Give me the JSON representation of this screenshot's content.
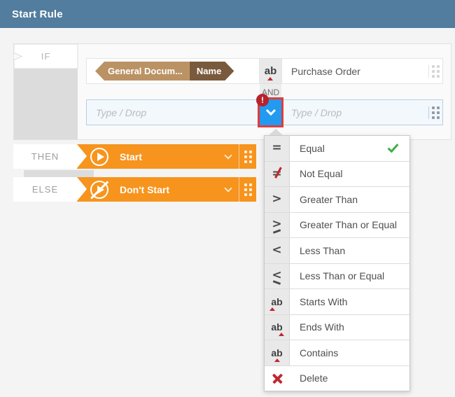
{
  "header": {
    "title": "Start Rule"
  },
  "rule": {
    "if_label": "IF",
    "and_label": "AND",
    "then_label": "THEN",
    "else_label": "ELSE",
    "condition1": {
      "tag_primary": "General Docum...",
      "tag_secondary": "Name",
      "operator_icon": "contains-icon",
      "value": "Purchase Order"
    },
    "condition2": {
      "left_placeholder": "Type / Drop",
      "right_placeholder": "Type / Drop",
      "error_badge": "!"
    },
    "then_action": "Start",
    "else_action": "Don't Start"
  },
  "operator_menu": {
    "items": [
      {
        "label": "Equal",
        "icon": "equal-icon",
        "selected": true
      },
      {
        "label": "Not Equal",
        "icon": "not-equal-icon",
        "selected": false
      },
      {
        "label": "Greater Than",
        "icon": "greater-than-icon",
        "selected": false
      },
      {
        "label": "Greater Than or Equal",
        "icon": "greater-than-or-equal-icon",
        "selected": false
      },
      {
        "label": "Less Than",
        "icon": "less-than-icon",
        "selected": false
      },
      {
        "label": "Less Than or Equal",
        "icon": "less-than-or-equal-icon",
        "selected": false
      },
      {
        "label": "Starts With",
        "icon": "starts-with-icon",
        "selected": false
      },
      {
        "label": "Ends With",
        "icon": "ends-with-icon",
        "selected": false
      },
      {
        "label": "Contains",
        "icon": "contains-icon",
        "selected": false
      },
      {
        "label": "Delete",
        "icon": "delete-icon",
        "selected": false
      }
    ]
  },
  "colors": {
    "header_bg": "#527d9e",
    "action_orange": "#f7941d",
    "tag_primary_bg": "#bb9264",
    "tag_secondary_bg": "#7a5a3c",
    "dropdown_blue": "#219af0",
    "selection_outline_red": "#e23b3b",
    "error_badge_red": "#b5242b",
    "operator_marker_red": "#c0272d",
    "check_green": "#3cb043"
  }
}
